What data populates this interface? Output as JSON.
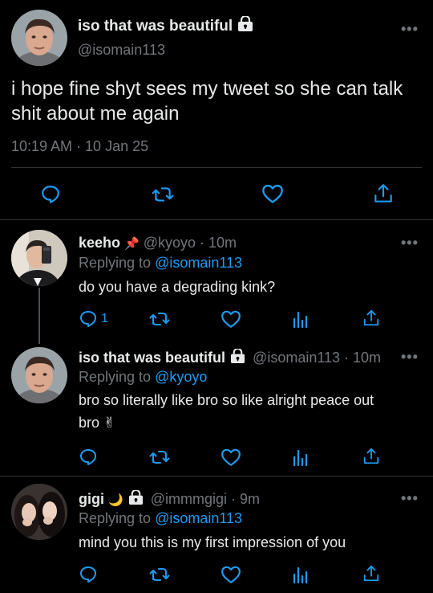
{
  "main_tweet": {
    "display_name": "iso that was beautiful",
    "handle": "@isomain113",
    "text_line1": "i hope fine shyt sees my tweet so she can talk",
    "text_line2": "shit about me again",
    "timestamp": "10:19 AM · 10 Jan 25",
    "more": "•••"
  },
  "replies": [
    {
      "display_name": "keeho",
      "emoji": "📌",
      "meta": "@kyoyo · 10m",
      "replying_prefix": "Replying to ",
      "replying_to": "@isomain113",
      "text_line1": "do you have a degrading kink?",
      "text_line2": "",
      "reply_count": "1",
      "more": "•••"
    },
    {
      "display_name": "iso that was beautiful",
      "meta": "@isomain113 · 10m",
      "replying_prefix": "Replying to ",
      "replying_to": "@kyoyo",
      "text_line1": "bro so literally like bro so like alright peace out",
      "text_line2": "bro ✌",
      "more": "•••"
    },
    {
      "display_name": "gigi",
      "emoji": "🌙",
      "meta": "@immmgigi · 9m",
      "replying_prefix": "Replying to ",
      "replying_to": "@isomain113",
      "text_line1": "mind you this is my first impression of you",
      "more": "•••"
    }
  ],
  "colors": {
    "background": "#000000",
    "muted": "#71767b",
    "link": "#1d9bf0",
    "divider": "#2f3336"
  }
}
